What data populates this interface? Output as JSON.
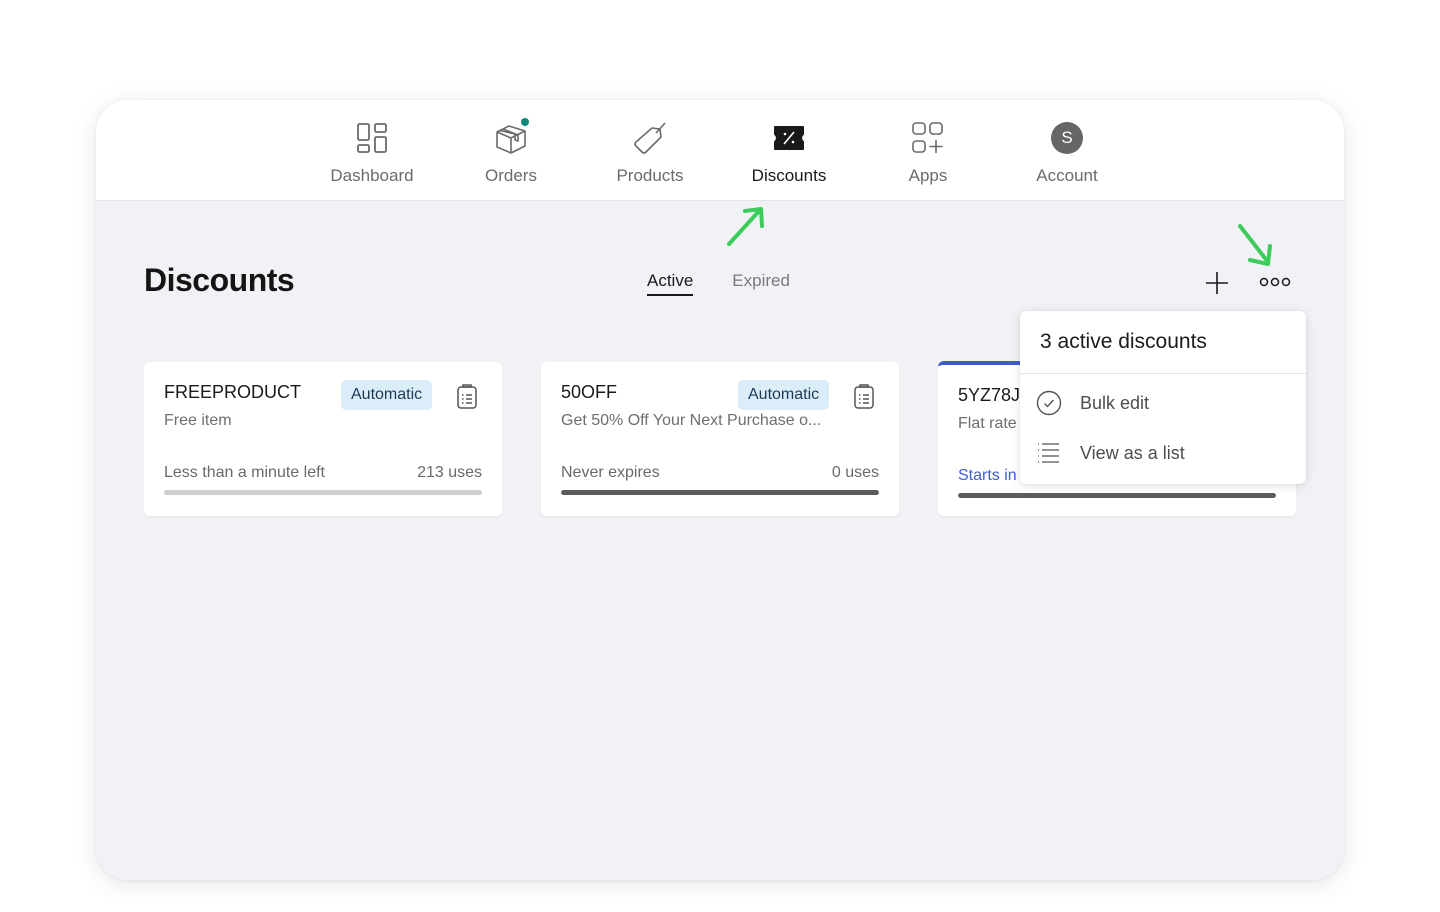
{
  "nav": {
    "items": [
      {
        "label": "Dashboard",
        "icon": "dashboard-icon",
        "active": false
      },
      {
        "label": "Orders",
        "icon": "box-icon",
        "active": false,
        "notification": true
      },
      {
        "label": "Products",
        "icon": "tag-icon",
        "active": false
      },
      {
        "label": "Discounts",
        "icon": "discount-ticket-icon",
        "active": true
      },
      {
        "label": "Apps",
        "icon": "apps-icon",
        "active": false
      },
      {
        "label": "Account",
        "icon": "avatar",
        "active": false,
        "avatar_initial": "S"
      }
    ]
  },
  "page": {
    "title": "Discounts",
    "tabs": [
      {
        "label": "Active",
        "active": true
      },
      {
        "label": "Expired",
        "active": false
      }
    ],
    "add_icon": "plus-icon",
    "more_icon": "more-horizontal-icon"
  },
  "discounts": [
    {
      "code": "FREEPRODUCT",
      "description": "Free item",
      "type": "Automatic",
      "status": "Less than a minute left",
      "uses": "213 uses",
      "progress": 0
    },
    {
      "code": "50OFF",
      "description": "Get 50% Off Your Next Purchase o...",
      "type": "Automatic",
      "status": "Never expires",
      "uses": "0 uses",
      "progress": 100
    },
    {
      "code": "5YZ78J",
      "description": "Flat rate",
      "type": "",
      "status": "Starts in",
      "uses": "",
      "progress": 100,
      "highlighted": true
    }
  ],
  "menu": {
    "header": "3 active discounts",
    "items": [
      {
        "label": "Bulk edit",
        "icon": "check-circle-icon"
      },
      {
        "label": "View as a list",
        "icon": "list-icon"
      }
    ]
  },
  "colors": {
    "accent_blue": "#3f5bd0",
    "badge_bg": "#dcedfa",
    "notification_dot": "#0b8a7a",
    "annotation_arrow": "#3dcc5c"
  }
}
